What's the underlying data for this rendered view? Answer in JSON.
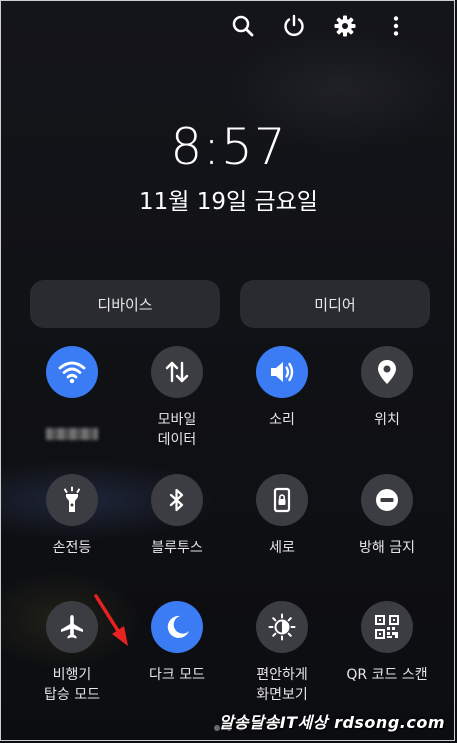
{
  "clock": "8:57",
  "date": "11월 19일 금요일",
  "top_actions": [
    "search-icon",
    "power-icon",
    "gear-icon",
    "more-vert-icon"
  ],
  "pills": {
    "device": "디바이스",
    "media": "미디어"
  },
  "tiles": [
    {
      "label": "",
      "icon": "wifi-icon",
      "active": true
    },
    {
      "label": "모바일\n데이터",
      "icon": "mobile-data-icon",
      "active": false
    },
    {
      "label": "소리",
      "icon": "sound-icon",
      "active": true
    },
    {
      "label": "위치",
      "icon": "location-icon",
      "active": false
    },
    {
      "label": "손전등",
      "icon": "flashlight-icon",
      "active": false
    },
    {
      "label": "블루투스",
      "icon": "bluetooth-icon",
      "active": false
    },
    {
      "label": "세로",
      "icon": "portrait-lock-icon",
      "active": false
    },
    {
      "label": "방해 금지",
      "icon": "do-not-disturb-icon",
      "active": false
    },
    {
      "label": "비행기\n탑승 모드",
      "icon": "airplane-icon",
      "active": false
    },
    {
      "label": "다크 모드",
      "icon": "moon-icon",
      "active": true
    },
    {
      "label": "편안하게\n화면보기",
      "icon": "eye-comfort-icon",
      "active": false
    },
    {
      "label": "QR 코드 스캔",
      "icon": "qr-code-icon",
      "active": false
    }
  ],
  "colors": {
    "active": "#3b7cf5",
    "inactive": "#3c3d42",
    "pill": "#2a2b30",
    "annotation_arrow": "#e8231f"
  },
  "watermark": "알송달송IT세상 rdsong.com"
}
